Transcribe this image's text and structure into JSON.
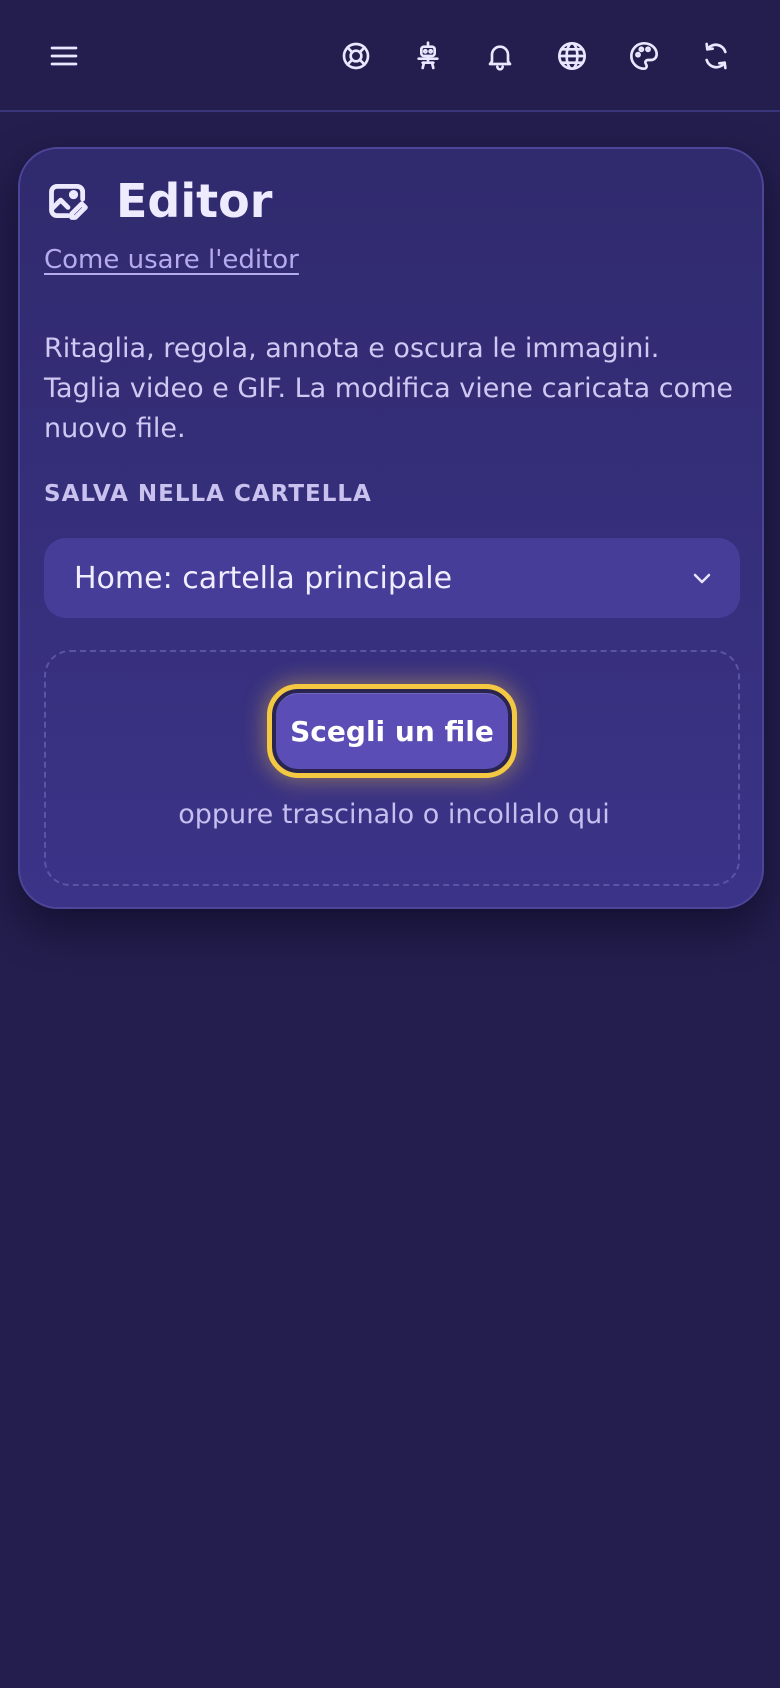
{
  "header": {
    "icons": [
      "menu-icon",
      "help-icon",
      "robot-icon",
      "bell-icon",
      "globe-icon",
      "palette-icon",
      "refresh-icon"
    ]
  },
  "editor": {
    "title": "Editor",
    "title_icon": "image-edit-icon",
    "help_link": "Come usare l'editor",
    "description": "Ritaglia, regola, annota e oscura le immagini. Taglia video e GIF. La modifica viene caricata come nuovo file.",
    "folder_label": "SALVA NELLA CARTELLA",
    "folder_value": "Home: cartella principale",
    "choose_button": "Scegli un file",
    "drop_hint": "oppure trascinalo o incollalo qui"
  },
  "colors": {
    "background": "#231e4d",
    "card": "#342d78",
    "select": "#463d99",
    "button": "#5a4db5",
    "focus_ring": "#f5c842",
    "link": "#b5acee"
  }
}
